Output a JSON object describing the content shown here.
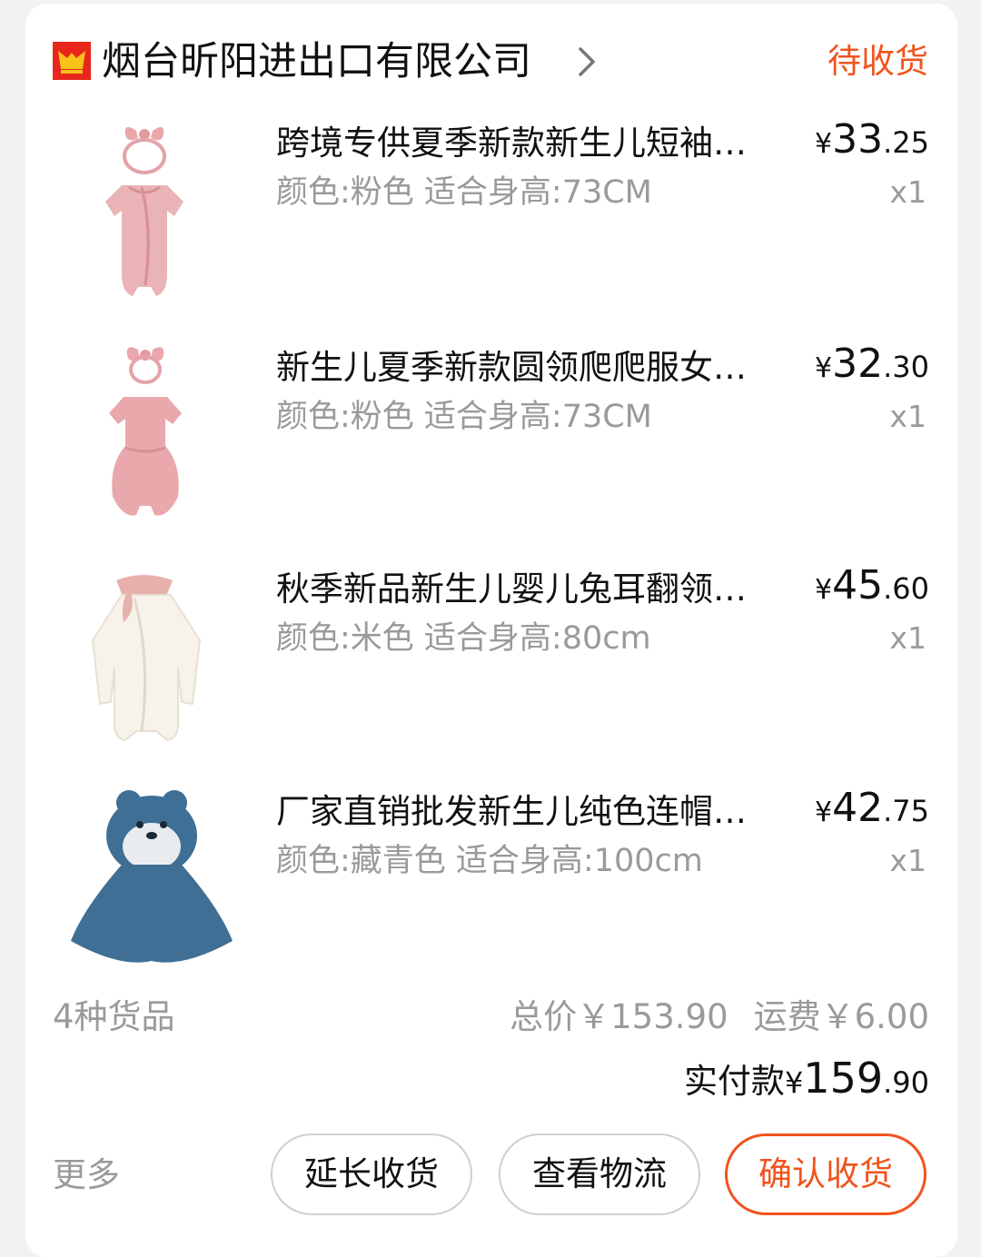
{
  "shop": {
    "name": "烟台昕阳进出口有限公司",
    "status": "待收货",
    "accent_color": "#f0541e",
    "logo_icon": "shop-logo-icon",
    "arrow_icon": "chevron-right-icon"
  },
  "items": [
    {
      "title": "跨境专供夏季新款新生儿短袖连...",
      "spec": "颜色:粉色 适合身高:73CM",
      "price_currency": "¥",
      "price_int": "33",
      "price_dec": ".25",
      "qty": "x1"
    },
    {
      "title": "新生儿夏季新款圆领爬爬服女宝...",
      "spec": "颜色:粉色 适合身高:73CM",
      "price_currency": "¥",
      "price_int": "32",
      "price_dec": ".30",
      "qty": "x1"
    },
    {
      "title": "秋季新品新生儿婴儿兔耳翻领连...",
      "spec": "颜色:米色 适合身高:80cm",
      "price_currency": "¥",
      "price_int": "45",
      "price_dec": ".60",
      "qty": "x1"
    },
    {
      "title": "厂家直销批发新生儿纯色连帽斗...",
      "spec": "颜色:藏青色 适合身高:100cm",
      "price_currency": "¥",
      "price_int": "42",
      "price_dec": ".75",
      "qty": "x1"
    }
  ],
  "summary": {
    "count_text": "4种货品",
    "total_text": "总价￥153.90",
    "shipping_text": "运费￥6.00",
    "paid_label": "实付款",
    "paid_currency": "¥",
    "paid_int": "159",
    "paid_dec": ".90"
  },
  "actions": {
    "more": "更多",
    "extend": "延长收货",
    "logistics": "查看物流",
    "confirm": "确认收货"
  }
}
